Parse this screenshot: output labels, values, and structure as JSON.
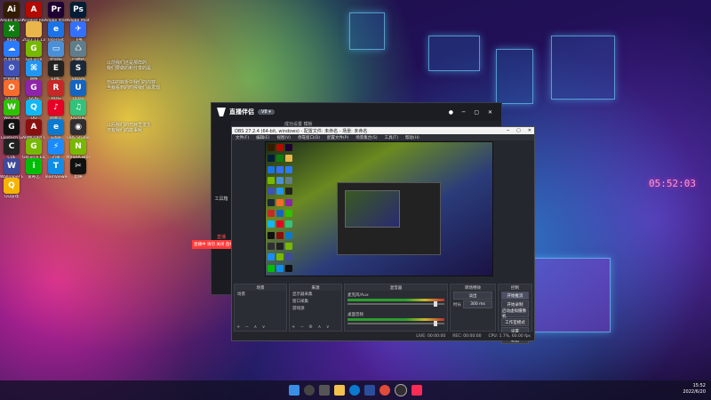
{
  "desktop_icons": [
    {
      "label": "Adobe Illustrator",
      "glyph": "Ai",
      "color": "#331c00"
    },
    {
      "label": "Acrobat Reader DC",
      "glyph": "A",
      "color": "#b30b00"
    },
    {
      "label": "Adobe Premiere",
      "glyph": "Pr",
      "color": "#1f0033"
    },
    {
      "label": "Adobe Photoshop",
      "glyph": "Ps",
      "color": "#001e36"
    },
    {
      "label": "Xbox",
      "glyph": "X",
      "color": "#107c10"
    },
    {
      "label": "2023.11.13",
      "glyph": "",
      "color": "#e8b64a"
    },
    {
      "label": "Internet",
      "glyph": "e",
      "color": "#1a73e8"
    },
    {
      "label": "飞书",
      "glyph": "✈",
      "color": "#3370ff"
    },
    {
      "label": "百度网盘",
      "glyph": "☁",
      "color": "#2a7bff"
    },
    {
      "label": "GeForce",
      "glyph": "G",
      "color": "#76b900"
    },
    {
      "label": "此电脑",
      "glyph": "▭",
      "color": "#4a90d9"
    },
    {
      "label": "回收站",
      "glyph": "♺",
      "color": "#607d8b"
    },
    {
      "label": "控制面板",
      "glyph": "⚙",
      "color": "#3f51b5"
    },
    {
      "label": "网络",
      "glyph": "⌘",
      "color": "#2196f3"
    },
    {
      "label": "EPIC",
      "glyph": "E",
      "color": "#222"
    },
    {
      "label": "Steam",
      "glyph": "S",
      "color": "#1b2838"
    },
    {
      "label": "Origin",
      "glyph": "O",
      "color": "#f56c2d"
    },
    {
      "label": "GOG",
      "glyph": "G",
      "color": "#8e24aa"
    },
    {
      "label": "ROG",
      "glyph": "R",
      "color": "#c62828"
    },
    {
      "label": "Uplay",
      "glyph": "U",
      "color": "#1565c0"
    },
    {
      "label": "WeChat",
      "glyph": "W",
      "color": "#2dc100"
    },
    {
      "label": "QQ",
      "glyph": "Q",
      "color": "#12b7f5"
    },
    {
      "label": "网易云",
      "glyph": "♪",
      "color": "#e60026"
    },
    {
      "label": "QQ音乐",
      "glyph": "♫",
      "color": "#31c27c"
    },
    {
      "label": "Logitech G",
      "glyph": "G",
      "color": "#111"
    },
    {
      "label": "ARMOURY CRATE",
      "glyph": "A",
      "color": "#8a1010"
    },
    {
      "label": "Edge",
      "glyph": "e",
      "color": "#0a7ad1"
    },
    {
      "label": "OBS Studio",
      "glyph": "◉",
      "color": "#302e31"
    },
    {
      "label": "CUE",
      "glyph": "C",
      "color": "#222"
    },
    {
      "label": "GeForce Experience",
      "glyph": "G",
      "color": "#76b900"
    },
    {
      "label": "迅雷",
      "glyph": "⚡",
      "color": "#1a8cff"
    },
    {
      "label": "NVIDIA Broadcast",
      "glyph": "N",
      "color": "#76b900"
    },
    {
      "label": "Wallpaper Engine",
      "glyph": "W",
      "color": "#3e4a9c"
    },
    {
      "label": "爱奇艺",
      "glyph": "i",
      "color": "#00be06"
    },
    {
      "label": "TeamViewer",
      "glyph": "T",
      "color": "#0e8ee9"
    },
    {
      "label": "剪映",
      "glyph": "✂",
      "color": "#111"
    },
    {
      "label": "QQ游戏",
      "glyph": "Q",
      "color": "#f4b400"
    }
  ],
  "wallpaper": {
    "clock": "05:52:03"
  },
  "floating_note": {
    "lines": [
      "以前我们还是那样的",
      "我们要做的和分享的是",
      "自由的转折中我们的内容",
      "当我看到的时候我们会发现",
      "以后我们的节目里发生",
      "还有我们的故事呢"
    ]
  },
  "live_assistant": {
    "title": "直播伴侣",
    "badge": "V8 ▾",
    "top_tab": "成功设置 模板",
    "side_items": [
      "工具箱",
      "直播"
    ],
    "tip": "直播中 请勿 关闭 直播"
  },
  "obs": {
    "title": "OBS 27.2.4 (64-bit, windows) - 配置文件: 未命名 - 场景: 未命名",
    "menu": [
      "文件(F)",
      "编辑(E)",
      "视图(V)",
      "停靠窗口(D)",
      "配置文件(P)",
      "场景集合(S)",
      "工具(T)",
      "帮助(H)"
    ],
    "docks": {
      "scenes": "场景",
      "sources": "来源",
      "mixer": "混音器",
      "transitions": "转场特效",
      "controls": "控制"
    },
    "scene_items": [
      "场景"
    ],
    "source_items": [
      "显示器采集",
      "窗口采集",
      "游戏源"
    ],
    "mixer_tracks": [
      "麦克风/Aux",
      "桌面音频"
    ],
    "transition": {
      "name": "淡出",
      "duration_label": "时长",
      "duration": "300 ms"
    },
    "control_buttons": [
      "开始推流",
      "开始录制",
      "启动虚拟摄像机",
      "工作室模式",
      "设置",
      "退出"
    ],
    "status": [
      "LIVE: 00:00:00",
      "REC: 00:00:00",
      "CPU: 1.7%, 60.00 fps"
    ]
  },
  "tray": {
    "time": "15:52",
    "date": "2022/6/20"
  }
}
